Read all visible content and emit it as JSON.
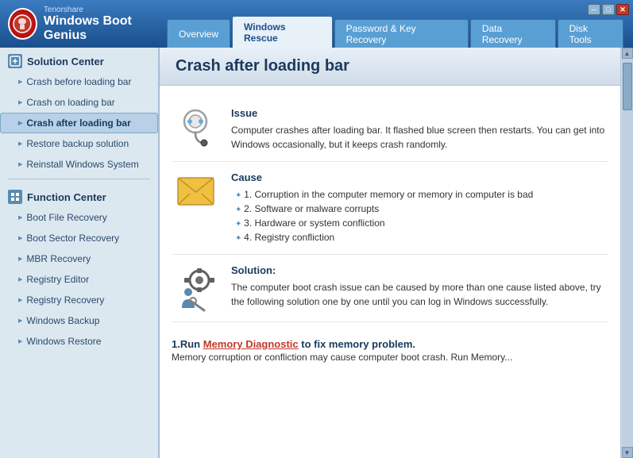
{
  "app": {
    "brand": "Tenorshare",
    "title": "Windows Boot Genius"
  },
  "win_controls": {
    "minimize": "─",
    "maximize": "□",
    "close": "✕"
  },
  "nav": {
    "tabs": [
      {
        "label": "Overview",
        "active": false
      },
      {
        "label": "Windows Rescue",
        "active": true
      },
      {
        "label": "Password & Key Recovery",
        "active": false
      },
      {
        "label": "Data Recovery",
        "active": false
      },
      {
        "label": "Disk Tools",
        "active": false
      }
    ]
  },
  "sidebar": {
    "section1_title": "Solution Center",
    "items_section1": [
      {
        "label": "Crash before loading bar",
        "active": false
      },
      {
        "label": "Crash on loading bar",
        "active": false
      },
      {
        "label": "Crash after loading bar",
        "active": true
      },
      {
        "label": "Restore backup solution",
        "active": false
      },
      {
        "label": "Reinstall Windows System",
        "active": false
      }
    ],
    "section2_title": "Function Center",
    "items_section2": [
      {
        "label": "Boot File Recovery",
        "active": false
      },
      {
        "label": "Boot Sector Recovery",
        "active": false
      },
      {
        "label": "MBR Recovery",
        "active": false
      },
      {
        "label": "Registry Editor",
        "active": false
      },
      {
        "label": "Registry Recovery",
        "active": false
      },
      {
        "label": "Windows Backup",
        "active": false
      },
      {
        "label": "Windows Restore",
        "active": false
      }
    ]
  },
  "content": {
    "title": "Crash after loading bar",
    "issue_title": "Issue",
    "issue_text": "Computer crashes after loading bar. It flashed blue screen then restarts. You can get into Windows occasionally, but it keeps crash randomly.",
    "cause_title": "Cause",
    "cause_items": [
      "1. Corruption in the computer memory or memory in computer is bad",
      "2. Software or malware corrupts",
      "3. Hardware or system confliction",
      "4. Registry confliction"
    ],
    "solution_title": "Solution:",
    "solution_text": "The computer boot crash issue can be caused by more than one cause listed above, try the following solution one by one until you can log in Windows successfully.",
    "step1_prefix": "1.Run ",
    "step1_link": "Memory Diagnostic",
    "step1_suffix": " to fix memory problem.",
    "step1_detail": "Memory corruption or confliction may cause computer boot crash. Run Memory..."
  }
}
